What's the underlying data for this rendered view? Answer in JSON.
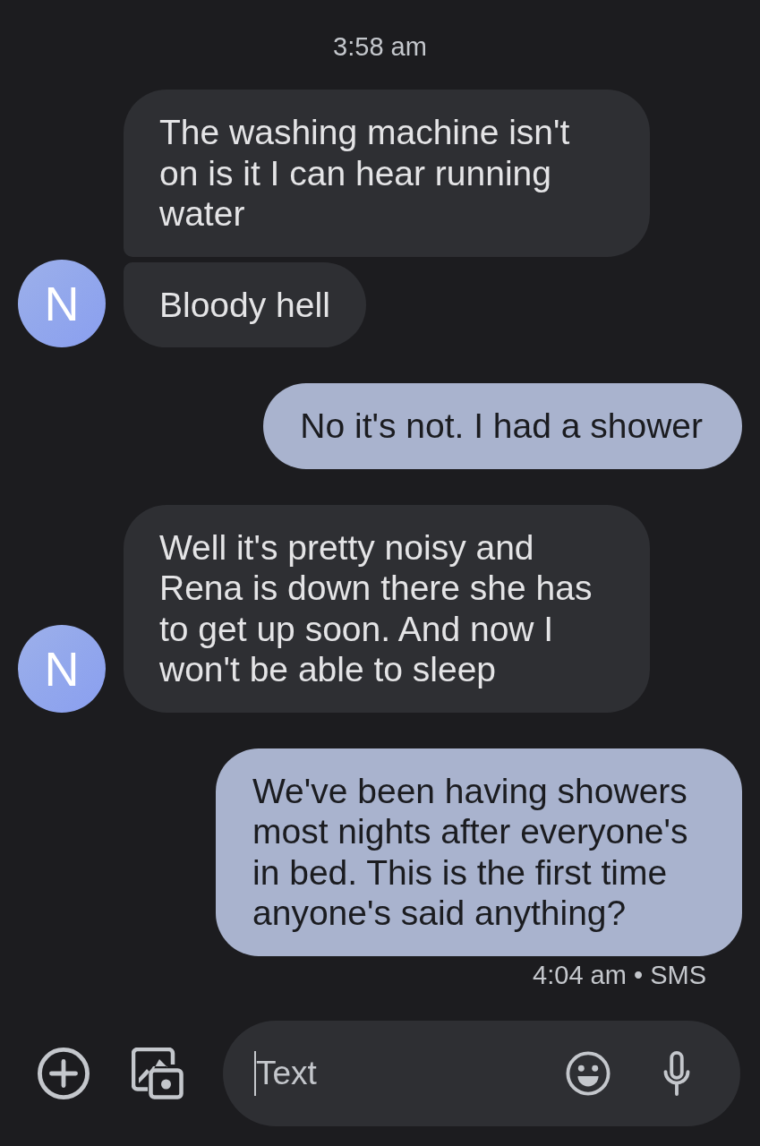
{
  "header": {
    "timestamp": "3:58 am"
  },
  "conversation": [
    {
      "kind": "incoming",
      "avatar_initial": "N",
      "bubbles": [
        "The washing machine isn't on is it I can hear running water",
        "Bloody hell"
      ]
    },
    {
      "kind": "outgoing",
      "bubbles": [
        "No it's not. I had a shower"
      ]
    },
    {
      "kind": "incoming",
      "avatar_initial": "N",
      "bubbles": [
        "Well it's pretty noisy and Rena is down there she has to get up soon. And now I won't be able to sleep"
      ]
    },
    {
      "kind": "outgoing",
      "bubbles": [
        "We've been having showers most nights after everyone's in bed. This is the first time anyone's said anything?"
      ],
      "status": "4:04 am • SMS"
    }
  ],
  "composer": {
    "placeholder": "Text"
  }
}
